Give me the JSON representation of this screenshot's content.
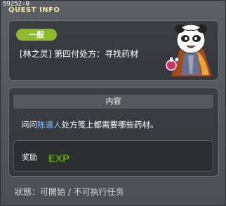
{
  "window": {
    "quest_id": "59252-0",
    "title": "QUEST INFO"
  },
  "quest": {
    "category": "一般",
    "name": "[林之灵] 第四付处方：寻找药材"
  },
  "content": {
    "section_title": "内容",
    "desc_before": "问问",
    "desc_npc": "陈道人",
    "desc_after": "处方笺上都需要哪些药材。"
  },
  "reward": {
    "label": "奖励",
    "exp_text": "EXP"
  },
  "status": {
    "text": "狀態：可開始 / 不可执行任务"
  }
}
